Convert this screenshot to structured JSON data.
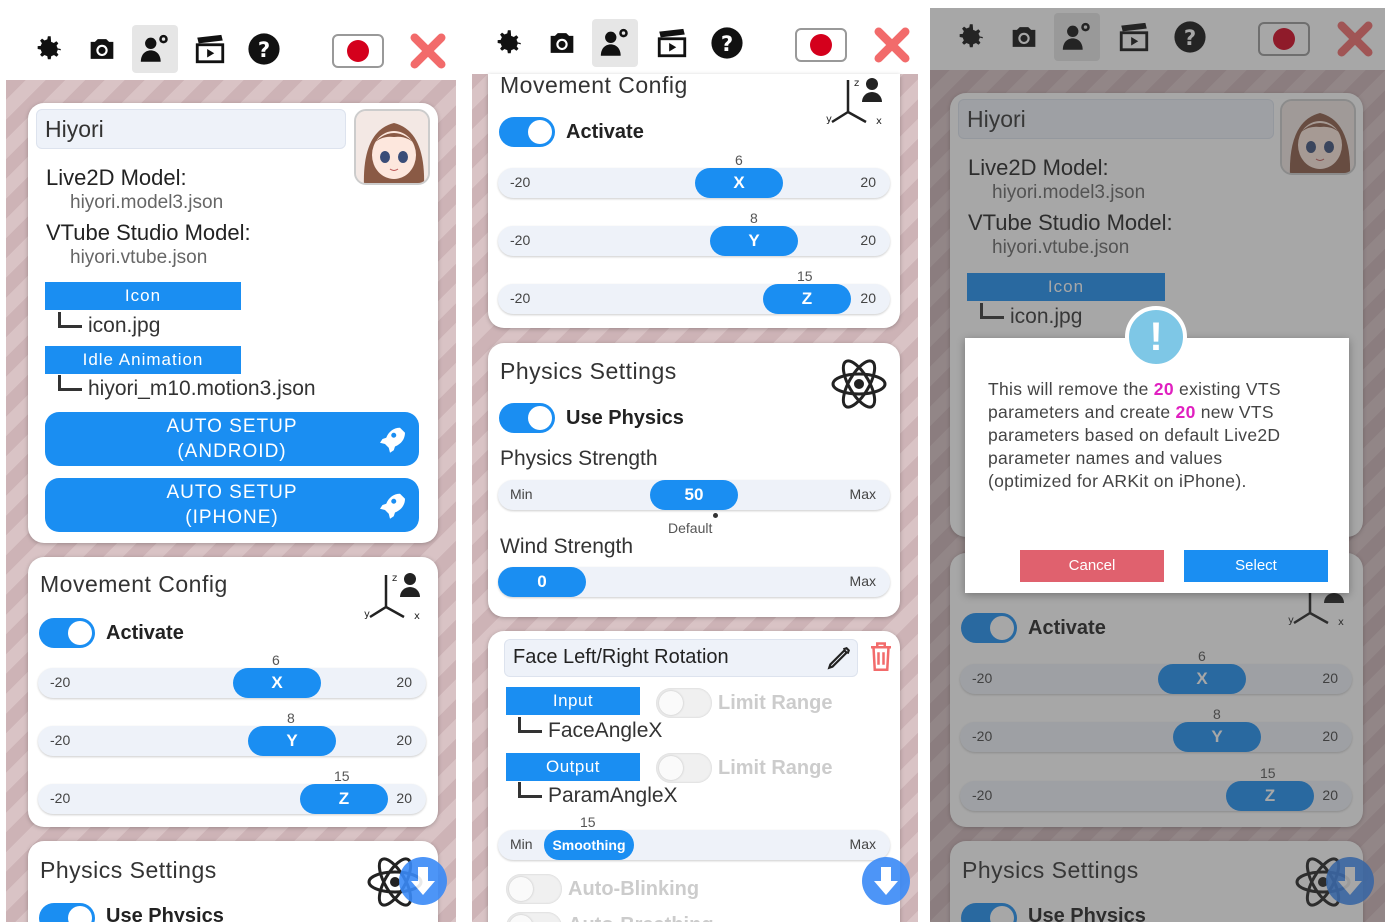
{
  "model": {
    "name": "Hiyori",
    "live2d_label": "Live2D Model:",
    "live2d_file": "hiyori.model3.json",
    "vts_label": "VTube Studio Model:",
    "vts_file": "hiyori.vtube.json",
    "icon_label": "Icon",
    "icon_file": "icon.jpg",
    "idle_label": "Idle Animation",
    "idle_file": "hiyori_m10.motion3.json",
    "auto_android_1": "AUTO SETUP",
    "auto_android_2": "(ANDROID)",
    "auto_iphone_1": "AUTO SETUP",
    "auto_iphone_2": "(IPHONE)"
  },
  "movement": {
    "title": "Movement Config",
    "activate": "Activate",
    "min": "-20",
    "max": "20",
    "x": {
      "label": "X",
      "value": "6"
    },
    "y": {
      "label": "Y",
      "value": "8"
    },
    "z": {
      "label": "Z",
      "value": "15"
    }
  },
  "physics": {
    "title": "Physics Settings",
    "use_physics": "Use Physics",
    "strength_label": "Physics Strength",
    "strength_value": "50",
    "min": "Min",
    "max": "Max",
    "default": "Default",
    "wind_label": "Wind Strength",
    "wind_value": "0"
  },
  "param": {
    "name": "Face Left/Right Rotation",
    "input": "Input",
    "input_value": "FaceAngleX",
    "output": "Output",
    "output_value": "ParamAngleX",
    "limit_range": "Limit Range",
    "smoothing_label": "Smoothing",
    "smoothing_value": "15",
    "min": "Min",
    "max": "Max",
    "auto_blinking": "Auto-Blinking",
    "auto_breathing": "Auto-Breathing"
  },
  "dialog": {
    "t1": "This will remove the ",
    "n1": "20",
    "t2": " existing VTS",
    "t3": "parameters and create ",
    "n2": "20",
    "t4": " new VTS",
    "t5": "parameters based on default Live2D",
    "t6": "parameter names and values",
    "t7": "(optimized for ARKit on iPhone).",
    "cancel": "Cancel",
    "select": "Select",
    "cancel_color": "#e0616e",
    "select_color": "#1a8ef2"
  },
  "icons": [
    "gear-icon",
    "camera-icon",
    "model-settings-icon",
    "clapperboard-icon",
    "help-icon",
    "flag-japan-icon",
    "close-icon",
    "rocket-icon",
    "xyz-axis-icon",
    "atom-icon",
    "pencil-icon",
    "trash-icon",
    "scroll-down-icon"
  ]
}
